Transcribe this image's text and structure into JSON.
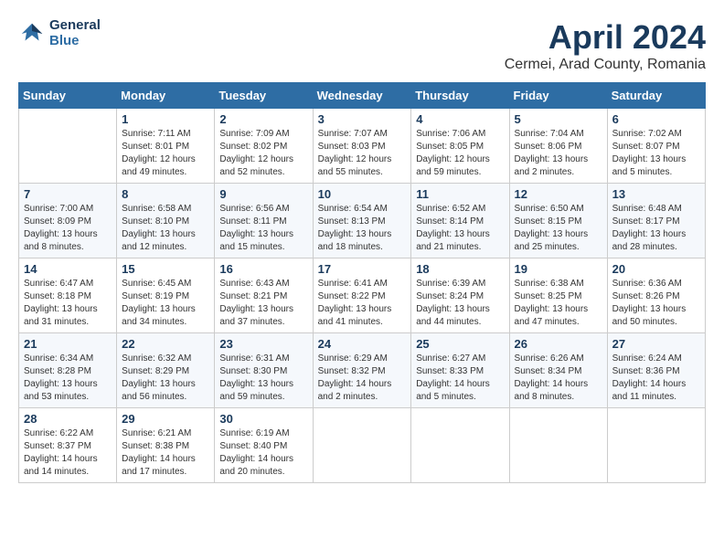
{
  "header": {
    "logo_line1": "General",
    "logo_line2": "Blue",
    "month": "April 2024",
    "location": "Cermei, Arad County, Romania"
  },
  "weekdays": [
    "Sunday",
    "Monday",
    "Tuesday",
    "Wednesday",
    "Thursday",
    "Friday",
    "Saturday"
  ],
  "weeks": [
    [
      {
        "day": "",
        "sunrise": "",
        "sunset": "",
        "daylight": ""
      },
      {
        "day": "1",
        "sunrise": "Sunrise: 7:11 AM",
        "sunset": "Sunset: 8:01 PM",
        "daylight": "Daylight: 12 hours and 49 minutes."
      },
      {
        "day": "2",
        "sunrise": "Sunrise: 7:09 AM",
        "sunset": "Sunset: 8:02 PM",
        "daylight": "Daylight: 12 hours and 52 minutes."
      },
      {
        "day": "3",
        "sunrise": "Sunrise: 7:07 AM",
        "sunset": "Sunset: 8:03 PM",
        "daylight": "Daylight: 12 hours and 55 minutes."
      },
      {
        "day": "4",
        "sunrise": "Sunrise: 7:06 AM",
        "sunset": "Sunset: 8:05 PM",
        "daylight": "Daylight: 12 hours and 59 minutes."
      },
      {
        "day": "5",
        "sunrise": "Sunrise: 7:04 AM",
        "sunset": "Sunset: 8:06 PM",
        "daylight": "Daylight: 13 hours and 2 minutes."
      },
      {
        "day": "6",
        "sunrise": "Sunrise: 7:02 AM",
        "sunset": "Sunset: 8:07 PM",
        "daylight": "Daylight: 13 hours and 5 minutes."
      }
    ],
    [
      {
        "day": "7",
        "sunrise": "Sunrise: 7:00 AM",
        "sunset": "Sunset: 8:09 PM",
        "daylight": "Daylight: 13 hours and 8 minutes."
      },
      {
        "day": "8",
        "sunrise": "Sunrise: 6:58 AM",
        "sunset": "Sunset: 8:10 PM",
        "daylight": "Daylight: 13 hours and 12 minutes."
      },
      {
        "day": "9",
        "sunrise": "Sunrise: 6:56 AM",
        "sunset": "Sunset: 8:11 PM",
        "daylight": "Daylight: 13 hours and 15 minutes."
      },
      {
        "day": "10",
        "sunrise": "Sunrise: 6:54 AM",
        "sunset": "Sunset: 8:13 PM",
        "daylight": "Daylight: 13 hours and 18 minutes."
      },
      {
        "day": "11",
        "sunrise": "Sunrise: 6:52 AM",
        "sunset": "Sunset: 8:14 PM",
        "daylight": "Daylight: 13 hours and 21 minutes."
      },
      {
        "day": "12",
        "sunrise": "Sunrise: 6:50 AM",
        "sunset": "Sunset: 8:15 PM",
        "daylight": "Daylight: 13 hours and 25 minutes."
      },
      {
        "day": "13",
        "sunrise": "Sunrise: 6:48 AM",
        "sunset": "Sunset: 8:17 PM",
        "daylight": "Daylight: 13 hours and 28 minutes."
      }
    ],
    [
      {
        "day": "14",
        "sunrise": "Sunrise: 6:47 AM",
        "sunset": "Sunset: 8:18 PM",
        "daylight": "Daylight: 13 hours and 31 minutes."
      },
      {
        "day": "15",
        "sunrise": "Sunrise: 6:45 AM",
        "sunset": "Sunset: 8:19 PM",
        "daylight": "Daylight: 13 hours and 34 minutes."
      },
      {
        "day": "16",
        "sunrise": "Sunrise: 6:43 AM",
        "sunset": "Sunset: 8:21 PM",
        "daylight": "Daylight: 13 hours and 37 minutes."
      },
      {
        "day": "17",
        "sunrise": "Sunrise: 6:41 AM",
        "sunset": "Sunset: 8:22 PM",
        "daylight": "Daylight: 13 hours and 41 minutes."
      },
      {
        "day": "18",
        "sunrise": "Sunrise: 6:39 AM",
        "sunset": "Sunset: 8:24 PM",
        "daylight": "Daylight: 13 hours and 44 minutes."
      },
      {
        "day": "19",
        "sunrise": "Sunrise: 6:38 AM",
        "sunset": "Sunset: 8:25 PM",
        "daylight": "Daylight: 13 hours and 47 minutes."
      },
      {
        "day": "20",
        "sunrise": "Sunrise: 6:36 AM",
        "sunset": "Sunset: 8:26 PM",
        "daylight": "Daylight: 13 hours and 50 minutes."
      }
    ],
    [
      {
        "day": "21",
        "sunrise": "Sunrise: 6:34 AM",
        "sunset": "Sunset: 8:28 PM",
        "daylight": "Daylight: 13 hours and 53 minutes."
      },
      {
        "day": "22",
        "sunrise": "Sunrise: 6:32 AM",
        "sunset": "Sunset: 8:29 PM",
        "daylight": "Daylight: 13 hours and 56 minutes."
      },
      {
        "day": "23",
        "sunrise": "Sunrise: 6:31 AM",
        "sunset": "Sunset: 8:30 PM",
        "daylight": "Daylight: 13 hours and 59 minutes."
      },
      {
        "day": "24",
        "sunrise": "Sunrise: 6:29 AM",
        "sunset": "Sunset: 8:32 PM",
        "daylight": "Daylight: 14 hours and 2 minutes."
      },
      {
        "day": "25",
        "sunrise": "Sunrise: 6:27 AM",
        "sunset": "Sunset: 8:33 PM",
        "daylight": "Daylight: 14 hours and 5 minutes."
      },
      {
        "day": "26",
        "sunrise": "Sunrise: 6:26 AM",
        "sunset": "Sunset: 8:34 PM",
        "daylight": "Daylight: 14 hours and 8 minutes."
      },
      {
        "day": "27",
        "sunrise": "Sunrise: 6:24 AM",
        "sunset": "Sunset: 8:36 PM",
        "daylight": "Daylight: 14 hours and 11 minutes."
      }
    ],
    [
      {
        "day": "28",
        "sunrise": "Sunrise: 6:22 AM",
        "sunset": "Sunset: 8:37 PM",
        "daylight": "Daylight: 14 hours and 14 minutes."
      },
      {
        "day": "29",
        "sunrise": "Sunrise: 6:21 AM",
        "sunset": "Sunset: 8:38 PM",
        "daylight": "Daylight: 14 hours and 17 minutes."
      },
      {
        "day": "30",
        "sunrise": "Sunrise: 6:19 AM",
        "sunset": "Sunset: 8:40 PM",
        "daylight": "Daylight: 14 hours and 20 minutes."
      },
      {
        "day": "",
        "sunrise": "",
        "sunset": "",
        "daylight": ""
      },
      {
        "day": "",
        "sunrise": "",
        "sunset": "",
        "daylight": ""
      },
      {
        "day": "",
        "sunrise": "",
        "sunset": "",
        "daylight": ""
      },
      {
        "day": "",
        "sunrise": "",
        "sunset": "",
        "daylight": ""
      }
    ]
  ]
}
